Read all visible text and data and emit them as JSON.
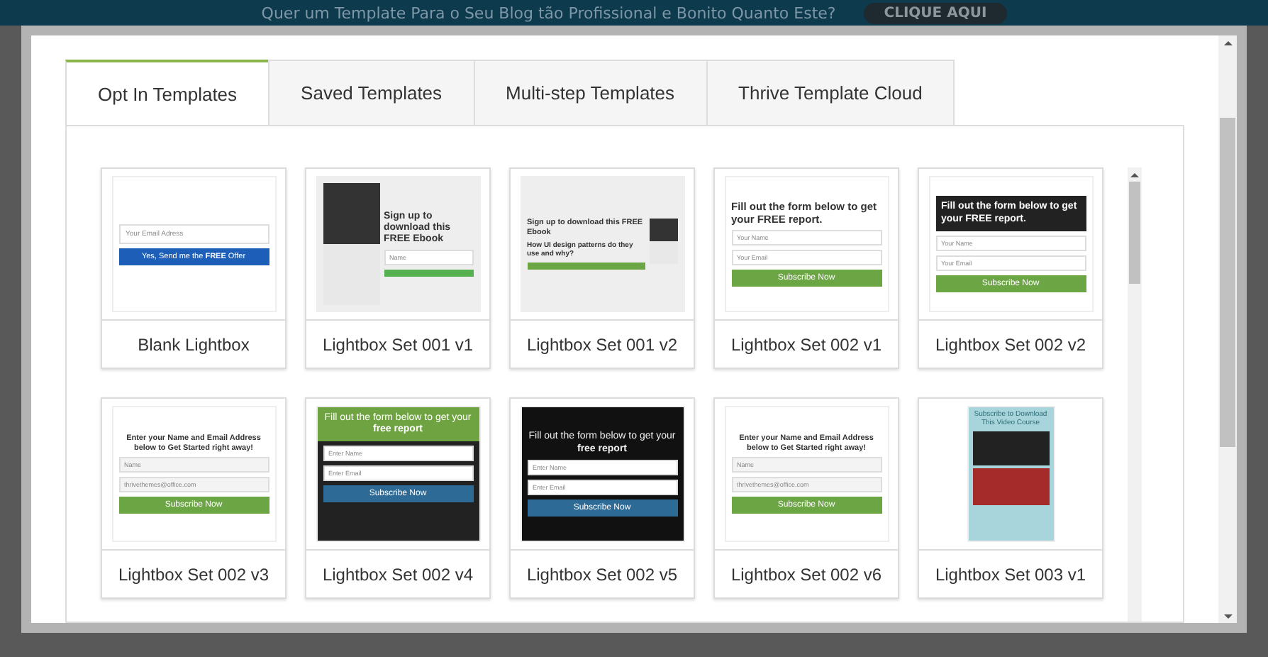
{
  "banner": {
    "text": "Quer um Template Para o Seu Blog tão Profissional e Bonito Quanto Este?",
    "button": "CLIQUE AQUI"
  },
  "tabs": [
    {
      "label": "Opt In Templates",
      "selected": true
    },
    {
      "label": "Saved Templates",
      "selected": false
    },
    {
      "label": "Multi-step Templates",
      "selected": false
    },
    {
      "label": "Thrive Template Cloud",
      "selected": false
    }
  ],
  "templates": [
    {
      "name": "Blank Lightbox",
      "kind": "blank",
      "fields": [
        "Your Email Adress"
      ],
      "button": "Yes, Send me the **FREE** Offer"
    },
    {
      "name": "Lightbox Set 001 v1",
      "kind": "ebook",
      "heading": "Sign up to download this **FREE** Ebook",
      "fields": [
        "Name"
      ]
    },
    {
      "name": "Lightbox Set 001 v2",
      "kind": "ebook-wide",
      "heading": "Sign up to download this **FREE** Ebook",
      "subheading": "How UI design patterns do they use and why?"
    },
    {
      "name": "Lightbox Set 002 v1",
      "kind": "light",
      "heading": "Fill out the form below to get your **FREE** report.",
      "fields": [
        "Your Name",
        "Your Email"
      ],
      "button": "Subscribe Now"
    },
    {
      "name": "Lightbox Set 002 v2",
      "kind": "dark-heading",
      "heading": "Fill out the form below to get your **FREE** report.",
      "fields": [
        "Your Name",
        "Your Email"
      ],
      "button": "Subscribe Now"
    },
    {
      "name": "Lightbox Set 002 v3",
      "kind": "enter",
      "heading": "Enter your Name and Email Address below to Get Started right away!",
      "fields": [
        "Name",
        "thrivethemes@office.com"
      ],
      "button": "Subscribe Now"
    },
    {
      "name": "Lightbox Set 002 v4",
      "kind": "green-header",
      "heading": "Fill out the form below to get your **free report**",
      "fields": [
        "Enter Name",
        "Enter Email"
      ],
      "button": "Subscribe Now"
    },
    {
      "name": "Lightbox Set 002 v5",
      "kind": "black",
      "heading": "Fill out the form below to get your **free report**",
      "fields": [
        "Enter Name",
        "Enter Email"
      ],
      "button": "Subscribe Now"
    },
    {
      "name": "Lightbox Set 002 v6",
      "kind": "enter",
      "heading": "Enter your Name and Email Address below to Get Started right away!",
      "fields": [
        "Name",
        "thrivethemes@office.com"
      ],
      "button": "Subscribe Now"
    },
    {
      "name": "Lightbox Set 003 v1",
      "kind": "video",
      "heading": "Subscribe to Download This Video Course"
    }
  ]
}
